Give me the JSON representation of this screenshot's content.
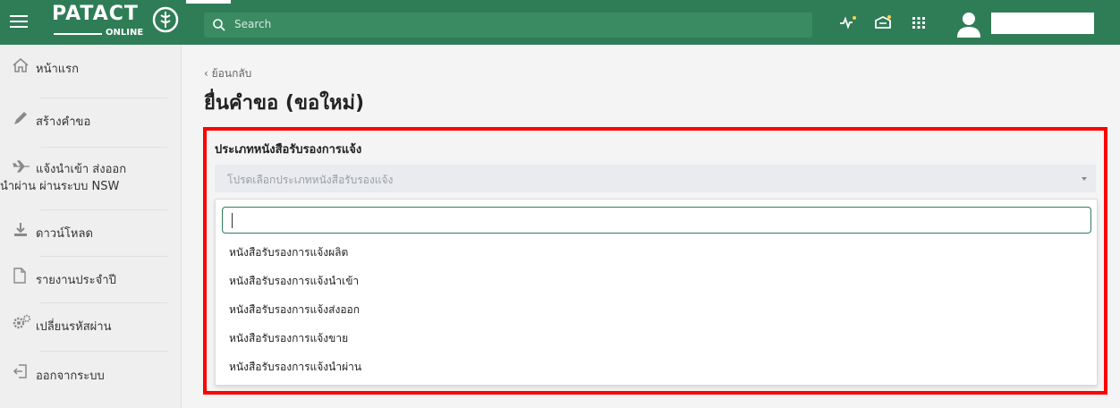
{
  "header": {
    "logo_text": "PATACT",
    "logo_sub": "ONLINE",
    "search_placeholder": "Search",
    "icons": [
      "activity-icon",
      "notification-icon",
      "apps-grid-icon",
      "user-avatar-icon"
    ]
  },
  "sidebar": {
    "items": [
      {
        "label": "หน้าแรก",
        "icon": "home-icon"
      },
      {
        "label": "สร้างคำขอ",
        "icon": "pencil-icon"
      },
      {
        "label": "แจ้งนำเข้า ส่งออก",
        "label_line2": "นำผ่าน ผ่านระบบ NSW",
        "icon": "airplane-icon"
      },
      {
        "label": "ดาวน์โหลด",
        "icon": "download-icon"
      },
      {
        "label": "รายงานประจำปี",
        "icon": "document-icon"
      },
      {
        "label": "เปลี่ยนรหัสผ่าน",
        "icon": "gears-icon"
      },
      {
        "label": "ออกจากระบบ",
        "icon": "logout-icon"
      }
    ]
  },
  "main": {
    "back_label": "ย้อนกลับ",
    "title": "ยื่นคำขอ (ขอใหม่)",
    "field_label": "ประเภทหนังสือรับรองการแจ้ง",
    "select_placeholder": "โปรดเลือกประเภทหนังสือรับรองแจ้ง",
    "options": [
      "หนังสือรับรองการแจ้งผลิต",
      "หนังสือรับรองการแจ้งนำเข้า",
      "หนังสือรับรองการแจ้งส่งออก",
      "หนังสือรับรองการแจ้งขาย",
      "หนังสือรับรองการแจ้งนำผ่าน"
    ]
  },
  "colors": {
    "header_green": "#2f7d57",
    "highlight_red": "#ff0000",
    "sidebar_bg": "#efefef"
  }
}
